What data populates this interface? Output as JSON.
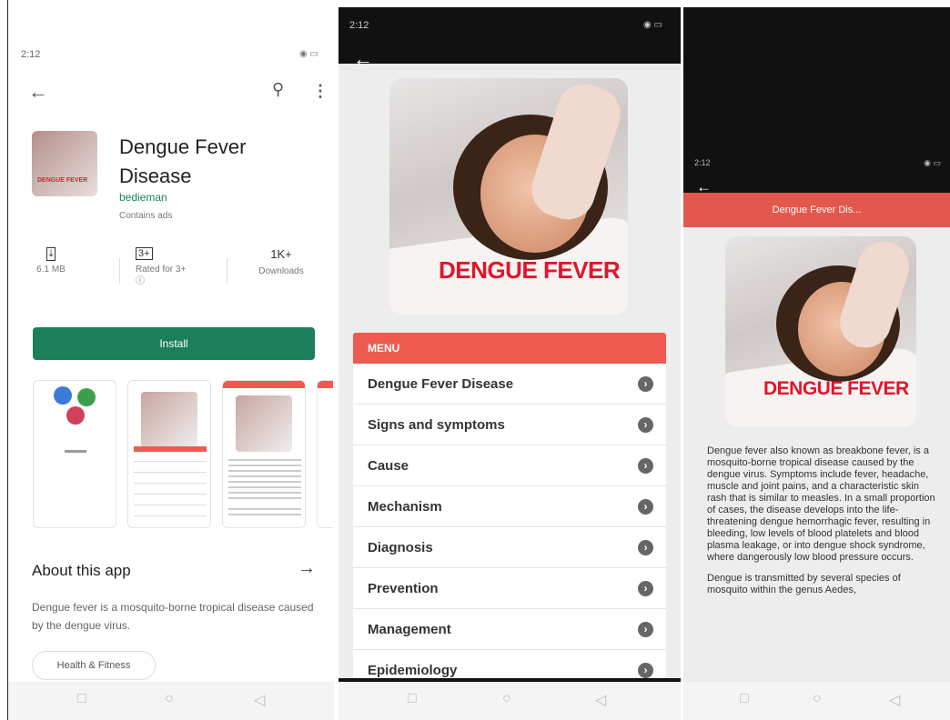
{
  "store": {
    "status_time": "2:12",
    "app_title": "Dengue Fever Disease",
    "developer": "bedieman",
    "ads_note": "Contains ads",
    "icon_caption": "DENGUE FEVER",
    "stats": {
      "size": "6.1 MB",
      "rating_badge": "3+",
      "rating_label": "Rated for 3+ ⓘ",
      "downloads_count": "1K+",
      "downloads_label": "Downloads"
    },
    "install_label": "Install",
    "about_title": "About this app",
    "about_text": "Dengue fever is a mosquito-borne tropical disease caused by the dengue virus.",
    "category_chip": "Health & Fitness"
  },
  "app": {
    "status_time": "2:12",
    "hero_caption": "DENGUE FEVER",
    "menu_header": "MENU",
    "menu_items": [
      "Dengue Fever Disease",
      "Signs and symptoms",
      "Cause",
      "Mechanism",
      "Diagnosis",
      "Prevention",
      "Management",
      "Epidemiology"
    ]
  },
  "detail": {
    "status_time": "2:12",
    "title": "Dengue Fever Dis...",
    "hero_caption": "DENGUE FEVER",
    "paragraph_1": "Dengue fever also known as breakbone fever, is a mosquito-borne tropical disease caused by the dengue virus. Symptoms include fever, headache, muscle and joint pains, and a characteristic skin rash that is similar to measles. In a small proportion of cases, the disease develops into the life-threatening dengue hemorrhagic fever, resulting in bleeding, low levels of blood platelets and blood plasma leakage, or into dengue shock syndrome, where dangerously low blood pressure occurs.",
    "paragraph_2": "Dengue is transmitted by several species of mosquito within the genus Aedes,"
  },
  "colors": {
    "accent_red": "#ee5a4e",
    "install_green": "#1a7f5a"
  }
}
